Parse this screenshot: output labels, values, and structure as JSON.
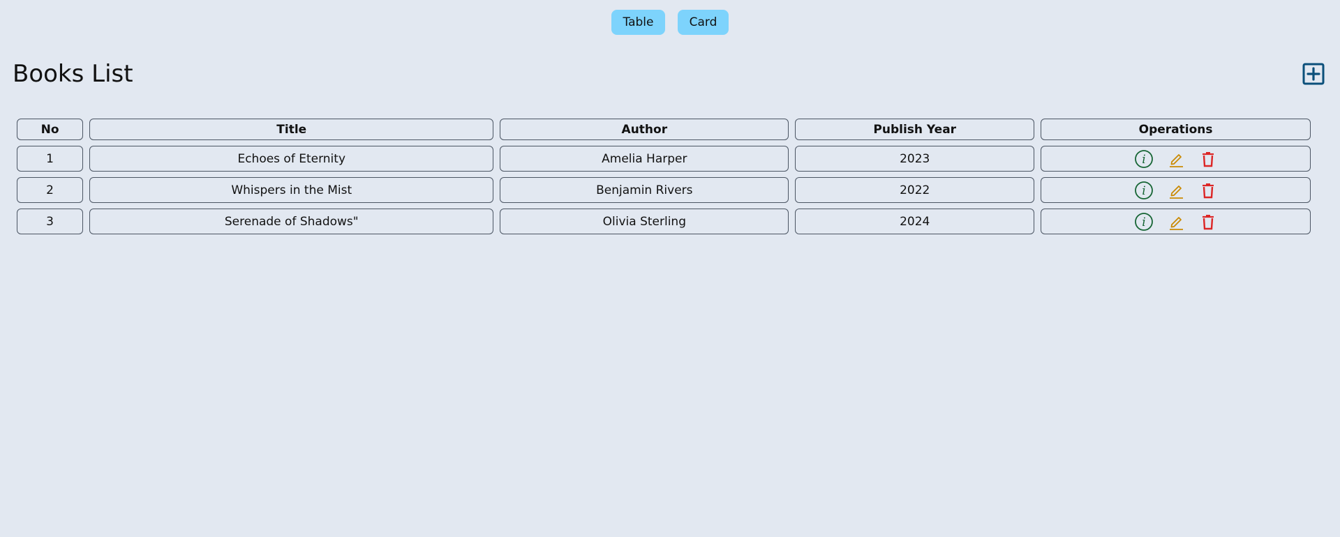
{
  "view_toggle": {
    "table_label": "Table",
    "card_label": "Card"
  },
  "page": {
    "title": "Books List"
  },
  "icons": {
    "add": "plus-square-icon",
    "info": "info-circle-icon",
    "edit": "pencil-icon",
    "delete": "trash-icon"
  },
  "colors": {
    "background": "#e2e8f1",
    "toggle_button": "#7dd3fc",
    "add_icon": "#0b4f7a",
    "info_icon": "#166534",
    "edit_icon": "#ca8a04",
    "delete_icon": "#dc2626"
  },
  "table": {
    "headers": [
      "No",
      "Title",
      "Author",
      "Publish Year",
      "Operations"
    ],
    "rows": [
      {
        "no": "1",
        "title": "Echoes of Eternity",
        "author": "Amelia Harper",
        "year": "2023"
      },
      {
        "no": "2",
        "title": "Whispers in the Mist",
        "author": "Benjamin Rivers",
        "year": "2022"
      },
      {
        "no": "3",
        "title": "Serenade of Shadows\"",
        "author": "Olivia Sterling",
        "year": "2024"
      }
    ]
  }
}
